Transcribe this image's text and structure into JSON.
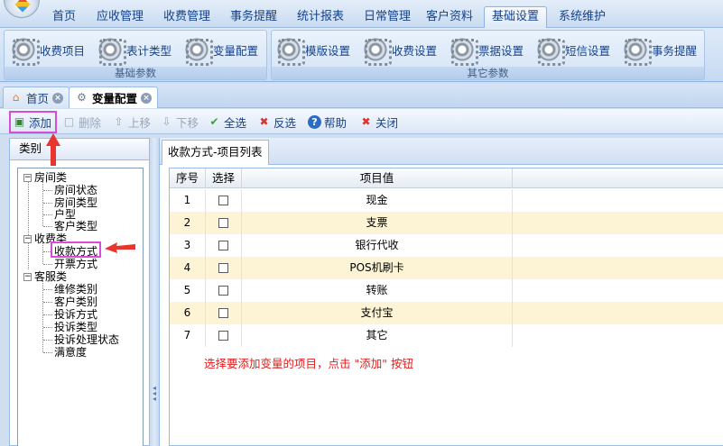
{
  "menu": {
    "tabs": [
      "首页",
      "应收管理",
      "收费管理",
      "事务提醒",
      "统计报表",
      "日常管理",
      "客户资料",
      "基础设置",
      "系统维护"
    ],
    "active_index": 7
  },
  "ribbon": {
    "groups": [
      {
        "label": "基础参数",
        "buttons": [
          "收费项目",
          "表计类型",
          "变量配置"
        ]
      },
      {
        "label": "其它参数",
        "buttons": [
          "模版设置",
          "收费设置",
          "票据设置",
          "短信设置",
          "事务提醒"
        ]
      }
    ]
  },
  "doc_tabs": [
    {
      "label": "首页",
      "icon": "home-icon"
    },
    {
      "label": "变量配置",
      "icon": "gear-icon"
    }
  ],
  "toolbar": {
    "add": "添加",
    "delete": "删除",
    "up": "上移",
    "down": "下移",
    "select_all": "全选",
    "invert": "反选",
    "help": "帮助",
    "close": "关闭"
  },
  "left_panel": {
    "title": "类别",
    "tree": [
      {
        "label": "房间类",
        "children": [
          "房间状态",
          "房间类型",
          "户型",
          "客户类型"
        ]
      },
      {
        "label": "收费类",
        "children": [
          "收款方式",
          "开票方式"
        ]
      },
      {
        "label": "客服类",
        "children": [
          "维修类别",
          "客户类别",
          "投诉方式",
          "投诉类型",
          "投诉处理状态",
          "满意度"
        ]
      }
    ]
  },
  "right_panel": {
    "tab": "收款方式-项目列表",
    "columns": [
      "序号",
      "选择",
      "项目值"
    ],
    "rows": [
      {
        "no": "1",
        "value": "现金"
      },
      {
        "no": "2",
        "value": "支票"
      },
      {
        "no": "3",
        "value": "银行代收"
      },
      {
        "no": "4",
        "value": "POS机刷卡"
      },
      {
        "no": "5",
        "value": "转账"
      },
      {
        "no": "6",
        "value": "支付宝"
      },
      {
        "no": "7",
        "value": "其它"
      }
    ],
    "hint": "选择要添加变量的项目，点击 \"添加\" 按钮"
  },
  "colors": {
    "accent": "#15428b",
    "row_alt": "#fcf4d4",
    "hint": "#e02020",
    "highlight": "#d94bd9"
  }
}
